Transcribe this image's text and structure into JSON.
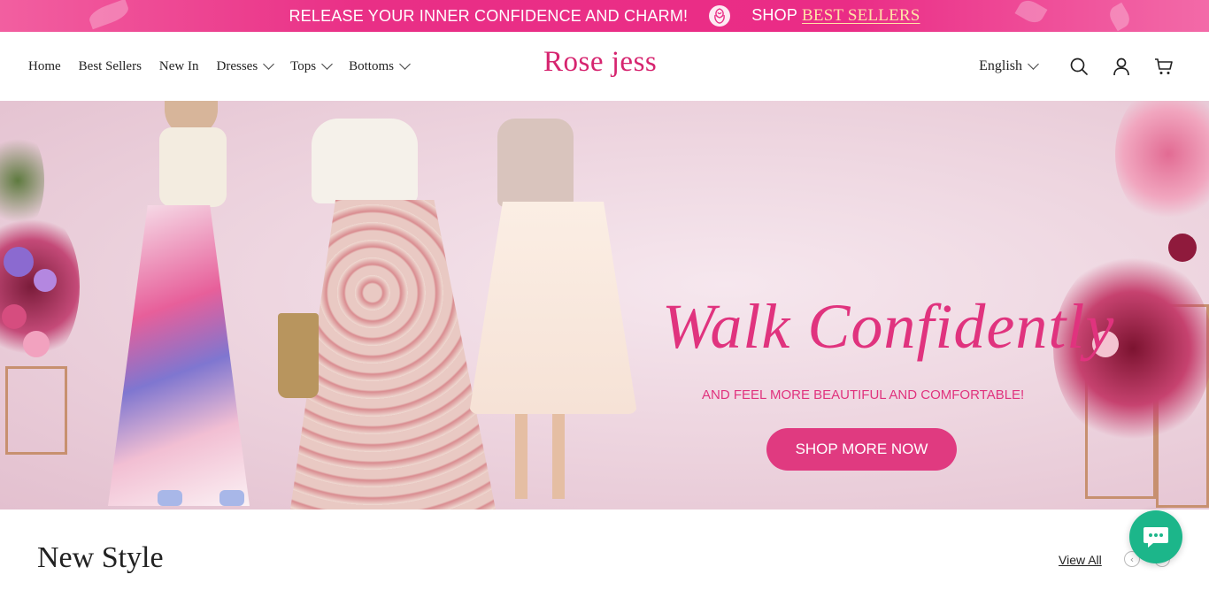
{
  "announcement": {
    "text": "RELEASE YOUR INNER CONFIDENCE AND CHARM!",
    "shop_label": "SHOP",
    "shop_link": "BEST SELLERS",
    "icon": "rose-icon"
  },
  "header": {
    "logo": "Rose jess",
    "nav": [
      {
        "label": "Home",
        "dropdown": false
      },
      {
        "label": "Best Sellers",
        "dropdown": false
      },
      {
        "label": "New In",
        "dropdown": false
      },
      {
        "label": "Dresses",
        "dropdown": true
      },
      {
        "label": "Tops",
        "dropdown": true
      },
      {
        "label": "Bottoms",
        "dropdown": true
      }
    ],
    "language": "English",
    "icons": [
      "search-icon",
      "account-icon",
      "cart-icon"
    ]
  },
  "hero": {
    "title": "Walk Confidently",
    "subtitle": "AND FEEL MORE BEAUTIFUL AND COMFORTABLE!",
    "cta": "SHOP MORE NOW"
  },
  "section": {
    "title": "New Style",
    "view_all": "View All"
  },
  "colors": {
    "brand": "#d6246f",
    "accent": "#e03a80",
    "announcement_bg": "#ea2c86",
    "chat": "#1cb68a"
  }
}
